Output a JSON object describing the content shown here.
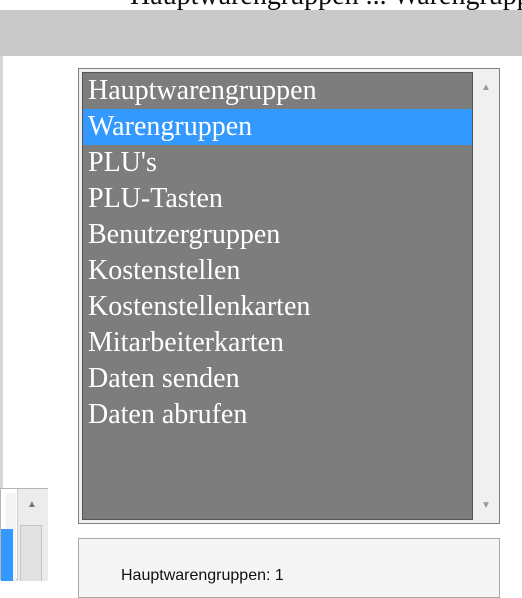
{
  "header": {
    "cut_text": "Hauptwarengruppen ... Warengruppen"
  },
  "list": {
    "items": [
      {
        "label": "Hauptwarengruppen",
        "selected": false
      },
      {
        "label": "Warengruppen",
        "selected": true
      },
      {
        "label": "PLU's",
        "selected": false
      },
      {
        "label": "PLU-Tasten",
        "selected": false
      },
      {
        "label": "Benutzergruppen",
        "selected": false
      },
      {
        "label": "Kostenstellen",
        "selected": false
      },
      {
        "label": "Kostenstellenkarten",
        "selected": false
      },
      {
        "label": "Mitarbeiterkarten",
        "selected": false
      },
      {
        "label": "Daten senden",
        "selected": false
      },
      {
        "label": "Daten abrufen",
        "selected": false
      }
    ],
    "selection_color": "#3399ff",
    "background_color": "#7d7d7d"
  },
  "scrollbar": {
    "up_icon": "triangle-up",
    "down_icon": "triangle-down"
  },
  "detail": {
    "text": "Hauptwarengruppen: 1"
  }
}
